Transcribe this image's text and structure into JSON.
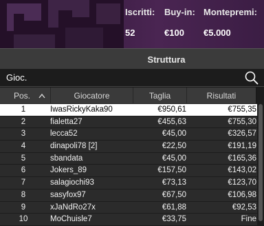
{
  "tournament_stats": {
    "iscritti_label": "Iscritti:",
    "iscritti_value": "52",
    "buyin_label": "Buy-in:",
    "buyin_value": "€100",
    "montepremi_label": "Montepremi:",
    "montepremi_value": "€5.000"
  },
  "section": {
    "title": "Struttura"
  },
  "search": {
    "label": "Gioc.",
    "icon": "search-icon"
  },
  "table": {
    "headers": {
      "pos": "Pos.",
      "player": "Giocatore",
      "taglia": "Taglia",
      "risultati": "Risultati"
    },
    "sort_icon": "chevron-up-icon",
    "rows": [
      {
        "pos": "1",
        "player": "IwasRickyKaka90",
        "taglia": "€950,61",
        "risultati": "€755,35",
        "selected": true
      },
      {
        "pos": "2",
        "player": "fialetta27",
        "taglia": "€455,63",
        "risultati": "€755,30"
      },
      {
        "pos": "3",
        "player": "lecca52",
        "taglia": "€45,00",
        "risultati": "€326,57"
      },
      {
        "pos": "4",
        "player": "dinapoli78 [2]",
        "taglia": "€22,50",
        "risultati": "€191,19"
      },
      {
        "pos": "5",
        "player": "sbandata",
        "taglia": "€45,00",
        "risultati": "€165,36"
      },
      {
        "pos": "6",
        "player": "Jokers_89",
        "taglia": "€157,50",
        "risultati": "€143,02"
      },
      {
        "pos": "7",
        "player": "salagiochi93",
        "taglia": "€73,13",
        "risultati": "€123,70"
      },
      {
        "pos": "8",
        "player": "sasyfox97",
        "taglia": "€67,50",
        "risultati": "€106,98"
      },
      {
        "pos": "9",
        "player": "xJaNdRo27x",
        "taglia": "€61,88",
        "risultati": "€92,53"
      },
      {
        "pos": "10",
        "player": "MoChuisle7",
        "taglia": "€33,75",
        "risultati": "Fine"
      }
    ]
  }
}
